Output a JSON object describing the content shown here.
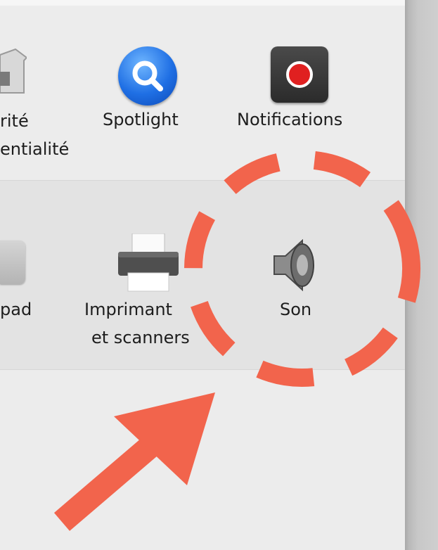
{
  "panes": {
    "row1": {
      "security": {
        "label_line1": "rité",
        "label_line2": "entialité"
      },
      "spotlight": {
        "label": "Spotlight"
      },
      "notifications": {
        "label": "Notifications"
      }
    },
    "row2": {
      "trackpad": {
        "label": "pad"
      },
      "printers": {
        "label_line1": "Imprimant",
        "label_line2": "et scanners"
      },
      "sound": {
        "label": "Son"
      }
    }
  },
  "annotation": {
    "color": "#f2644c",
    "shape": "dashed-circle-and-arrow"
  }
}
